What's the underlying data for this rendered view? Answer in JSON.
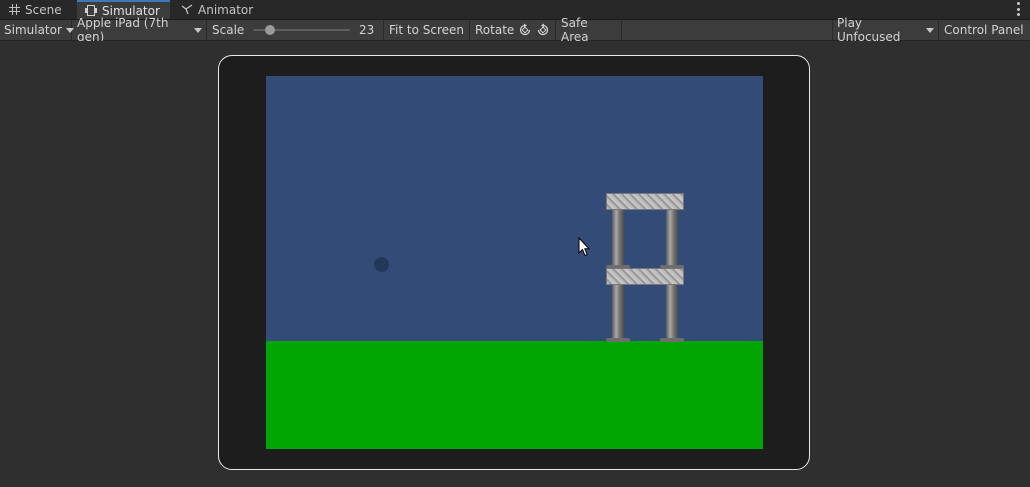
{
  "tabs": [
    {
      "label": "Scene",
      "icon": "grid-icon",
      "active": false
    },
    {
      "label": "Simulator",
      "icon": "device-icon",
      "active": true
    },
    {
      "label": "Animator",
      "icon": "animator-icon",
      "active": false
    }
  ],
  "toolbar": {
    "view_dropdown": "Simulator",
    "device_dropdown": "Apple iPad (7th gen)",
    "scale_label": "Scale",
    "scale_value": "23",
    "fit_button": "Fit to Screen",
    "rotate_label": "Rotate",
    "safe_area_button": "Safe Area",
    "play_mode_dropdown": "Play Unfocused",
    "control_panel_button": "Control Panel"
  },
  "colors": {
    "sky": "#324c77",
    "ground": "#01a602",
    "ball": "#233757",
    "accent": "#3a79bb"
  }
}
